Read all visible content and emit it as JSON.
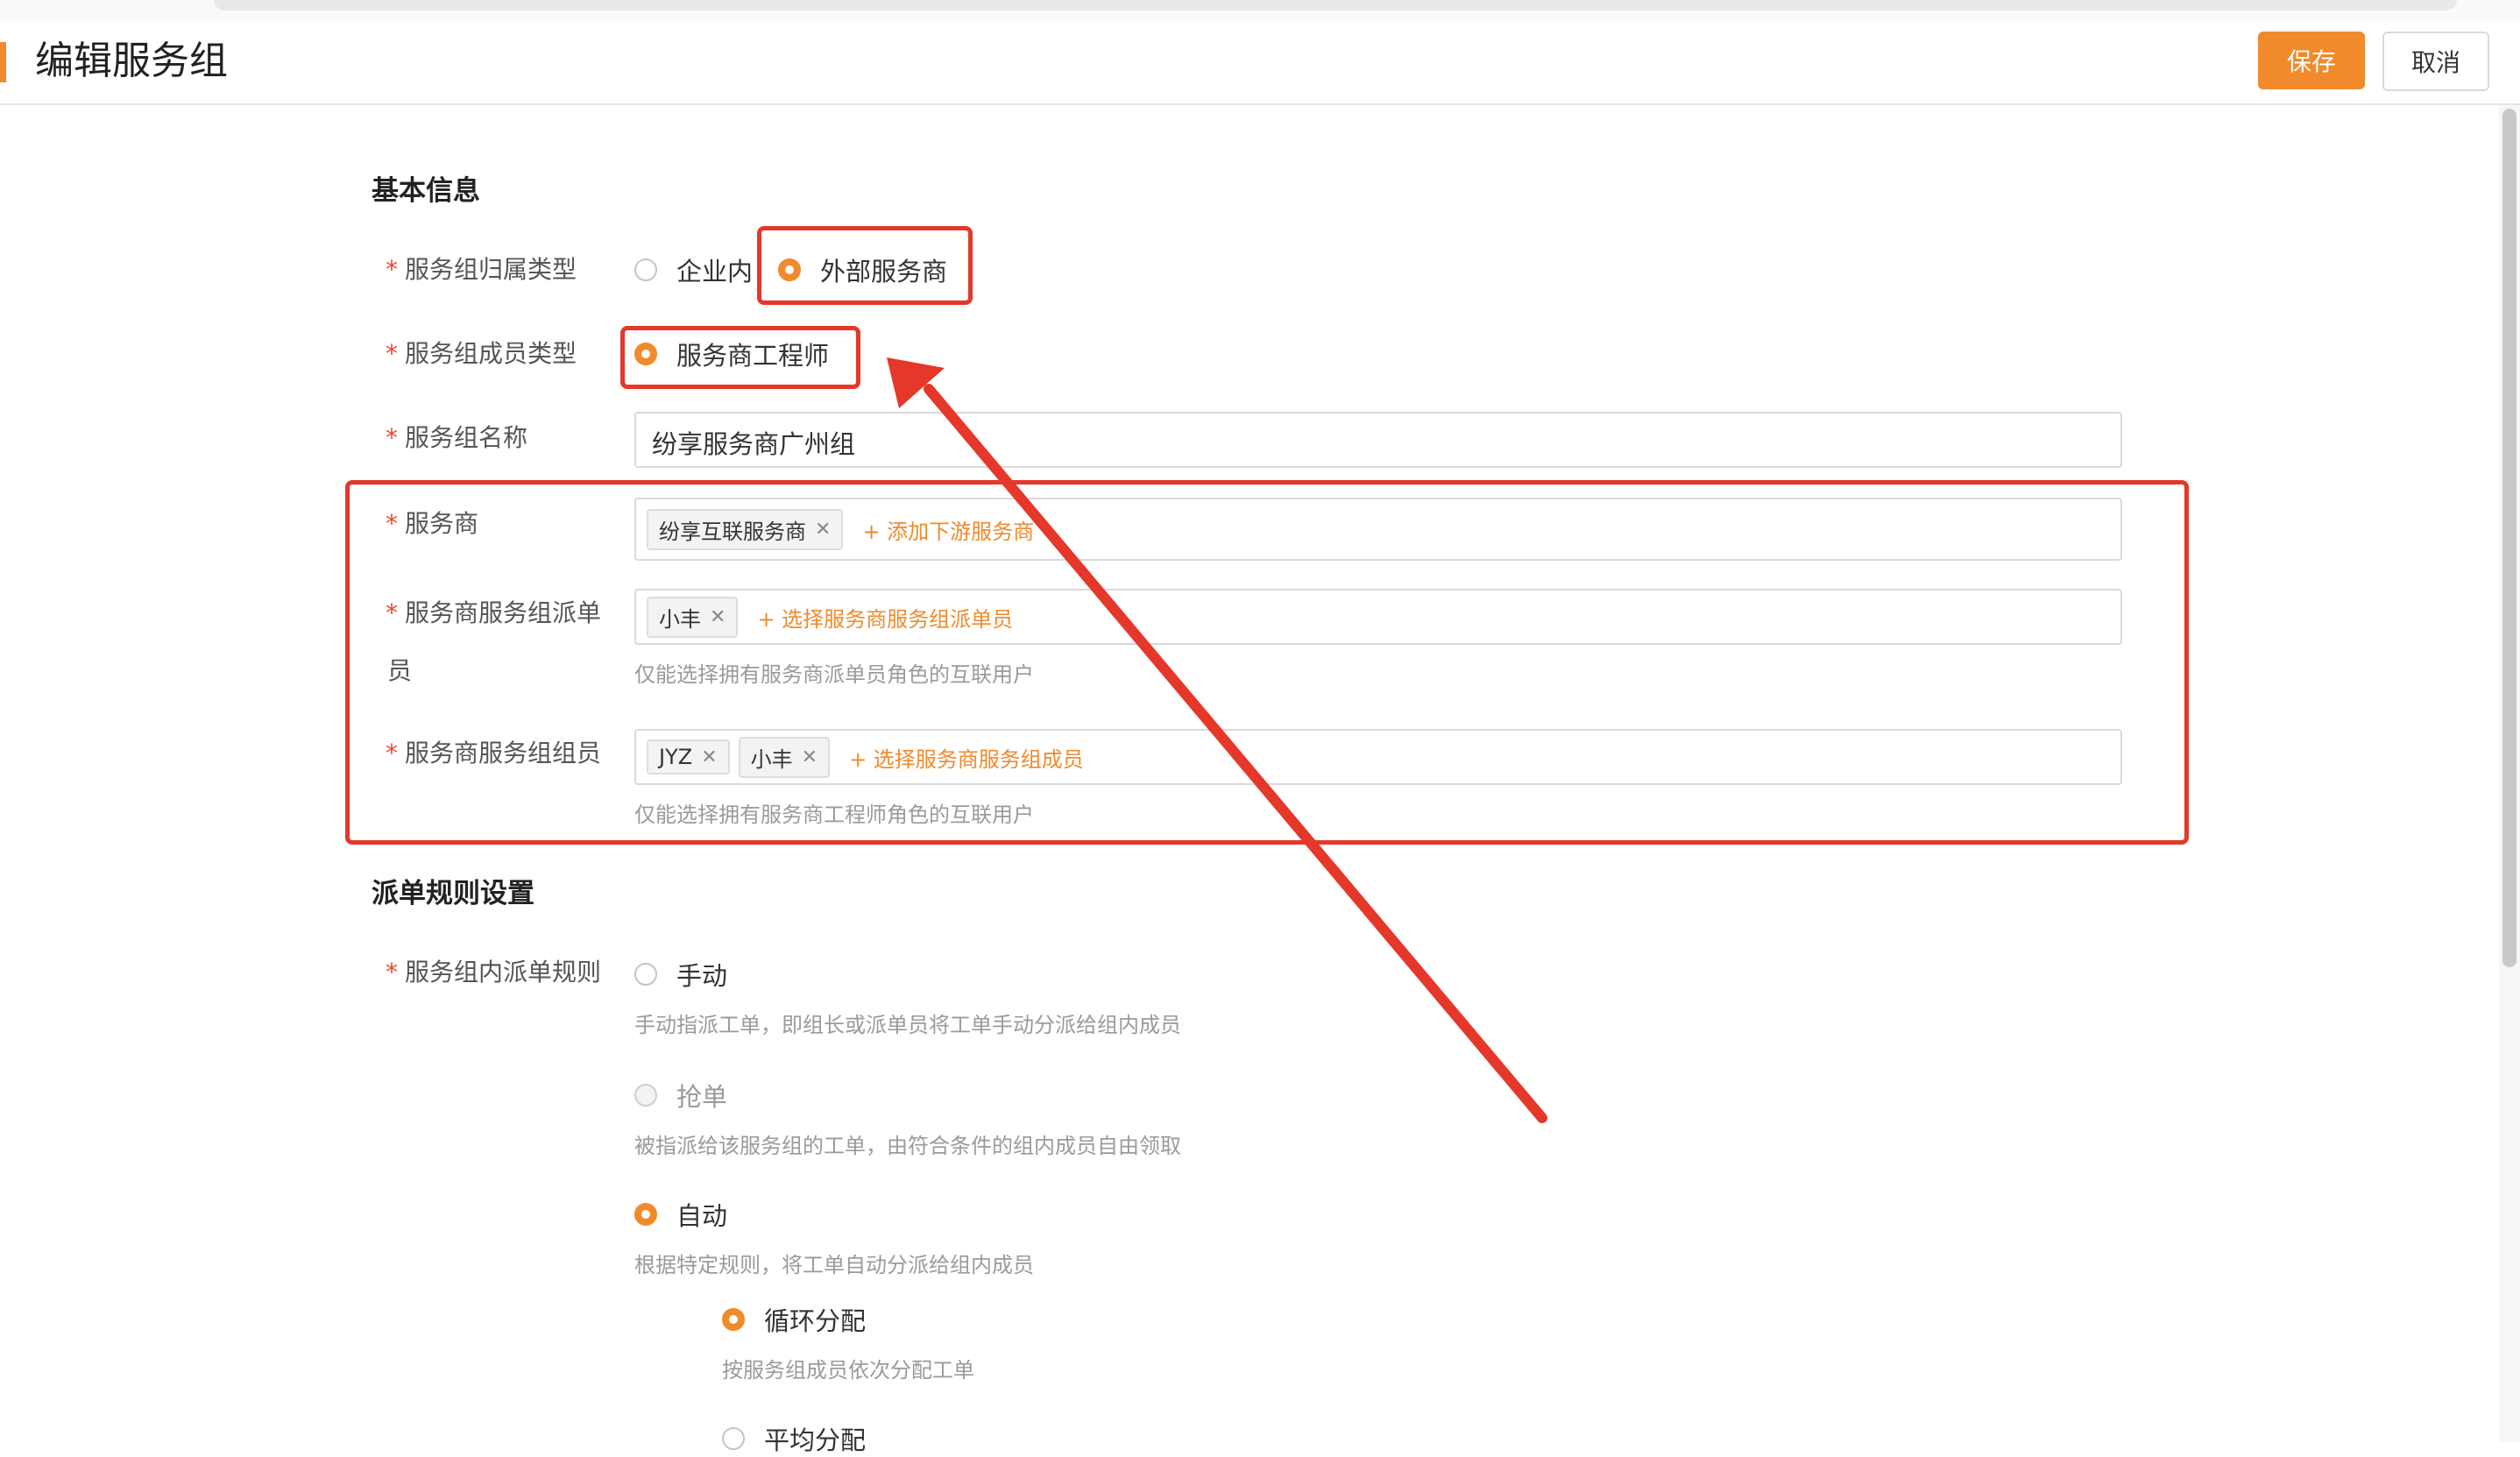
{
  "header": {
    "title": "编辑服务组",
    "save_label": "保存",
    "cancel_label": "取消"
  },
  "basic": {
    "section_title": "基本信息",
    "required_mark": "*",
    "owner_type": {
      "label": "服务组归属类型",
      "options": [
        "企业内",
        "外部服务商"
      ],
      "selected": "外部服务商"
    },
    "member_type": {
      "label": "服务组成员类型",
      "options": [
        "服务商工程师"
      ],
      "selected": "服务商工程师"
    },
    "group_name": {
      "label": "服务组名称",
      "value": "纷享服务商广州组"
    },
    "provider": {
      "label": "服务商",
      "tags": [
        "纷享互联服务商"
      ],
      "add_label": "+ 添加下游服务商"
    },
    "dispatcher": {
      "label_line1": "服务商服务组派单",
      "label_line2": "员",
      "tags": [
        "小丰"
      ],
      "add_label": "+ 选择服务商服务组派单员",
      "help": "仅能选择拥有服务商派单员角色的互联用户"
    },
    "members": {
      "label": "服务商服务组组员",
      "tags": [
        "JYZ",
        "小丰"
      ],
      "add_label": "+ 选择服务商服务组成员",
      "help": "仅能选择拥有服务商工程师角色的互联用户"
    }
  },
  "dispatch": {
    "section_title": "派单规则设置",
    "rule_label": "服务组内派单规则",
    "options": [
      {
        "label": "手动",
        "desc": "手动指派工单，即组长或派单员将工单手动分派给组内成员",
        "state": "off"
      },
      {
        "label": "抢单",
        "desc": "被指派给该服务组的工单，由符合条件的组内成员自由领取",
        "state": "disabled"
      },
      {
        "label": "自动",
        "desc": "根据特定规则，将工单自动分派给组内成员",
        "state": "on"
      }
    ],
    "auto_sub": [
      {
        "label": "循环分配",
        "desc": "按服务组成员依次分配工单",
        "state": "on"
      },
      {
        "label": "平均分配",
        "state": "off"
      }
    ]
  },
  "colors": {
    "accent": "#f08a2b",
    "annotation_red": "#e5372a",
    "required_red": "#e8492f"
  }
}
